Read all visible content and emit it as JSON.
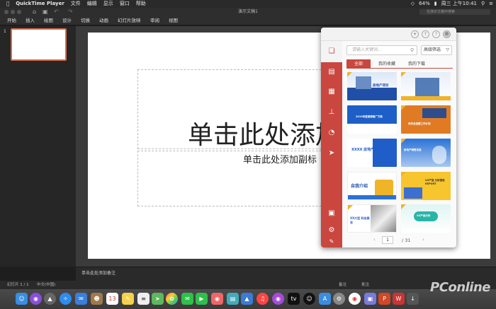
{
  "menubar": {
    "app_name": "QuickTime Player",
    "items": [
      "文件",
      "编辑",
      "显示",
      "窗口",
      "帮助"
    ],
    "status": {
      "wifi_pct": "64%",
      "clock": "周三 上午10:41"
    }
  },
  "window": {
    "title": "演示文稿1",
    "search_placeholder": "在演示文稿中搜索"
  },
  "ribbon": {
    "tabs": [
      "开始",
      "插入",
      "绘图",
      "设计",
      "切换",
      "动画",
      "幻灯片放映",
      "审阅",
      "视图"
    ]
  },
  "slide_panel": {
    "slide_number": "1"
  },
  "slide": {
    "title_placeholder": "单击此处添加",
    "subtitle_placeholder": "单击此处添加副标"
  },
  "notes": {
    "placeholder": "单击此处添加备注"
  },
  "statusbar": {
    "slide_info": "幻灯片 1 / 1",
    "language": "中文(中国)",
    "notes_label": "备注",
    "comments_label": "批注"
  },
  "panel": {
    "search_placeholder": "请输入关键词...",
    "advanced_filter": "高级筛选",
    "tabs": [
      "全部",
      "我的收藏",
      "我的下载"
    ],
    "active_tab": "全部",
    "templates": [
      {
        "label": "房地产项目",
        "color": "#1f4fa8"
      },
      {
        "label": "",
        "color": "#2d5fa8"
      },
      {
        "label": "2019年度营销推广方案",
        "color": "#1e5fc7"
      },
      {
        "label": "年终总结暨工作计划",
        "color": "#e07b24"
      },
      {
        "label": "XXXX 房地产业",
        "color": "#1f5ec9"
      },
      {
        "label": "房地产销售总结",
        "color": "#2a72d8"
      },
      {
        "label": "自我介绍",
        "color": "#ffffff"
      },
      {
        "label": "XX产品 分析报告 REPORT",
        "color": "#f7c52d"
      },
      {
        "label": "XX大型 科技展会",
        "color": "#ffffff"
      },
      {
        "label": "XX产品分析",
        "color": "#29b5a6"
      }
    ],
    "pager": {
      "current": "1",
      "total": "/ 31"
    }
  },
  "watermark": "PConline",
  "accent_color": "#c9473f"
}
